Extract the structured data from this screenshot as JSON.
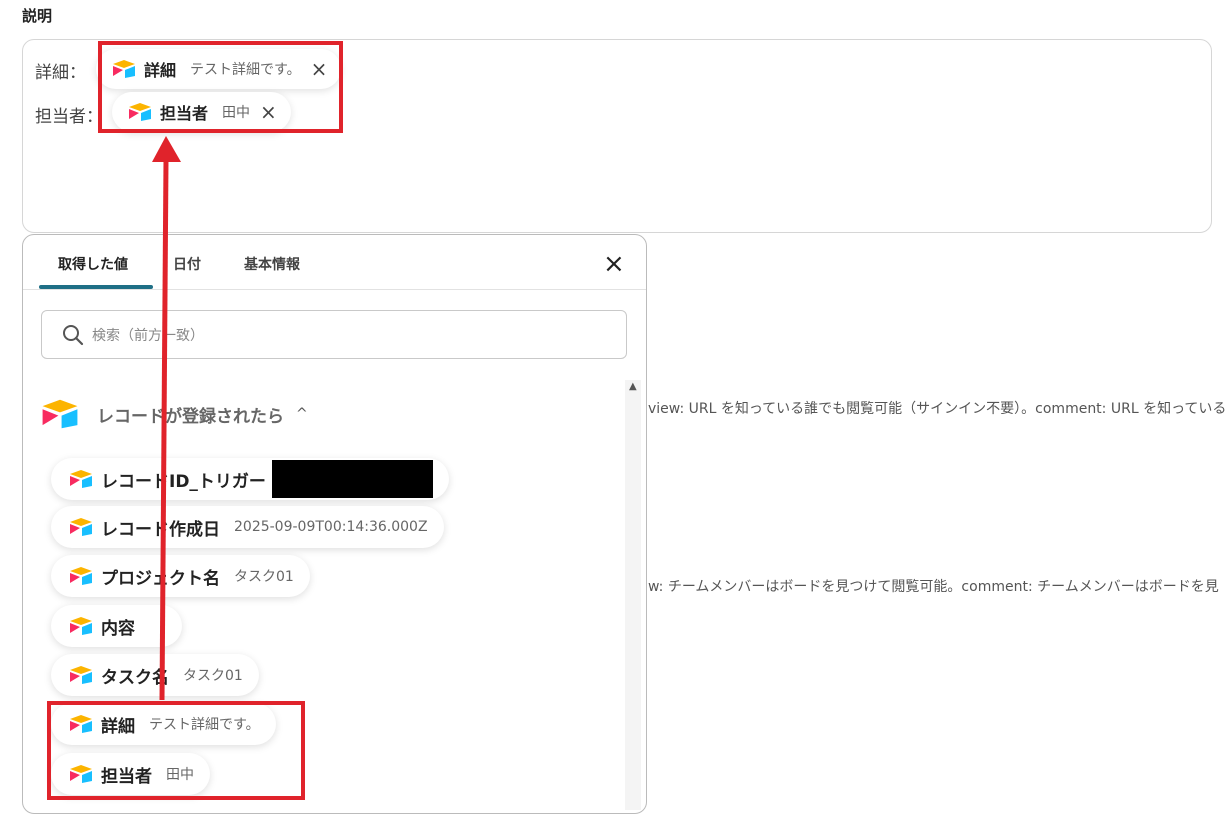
{
  "section_label": "説明",
  "description_field": {
    "rows": [
      {
        "label": "詳細：",
        "chip_name": "詳細",
        "chip_value": "テスト詳細です。",
        "remove": "×"
      },
      {
        "label": "担当者：",
        "chip_name": "担当者",
        "chip_value": "田中",
        "remove": "×"
      }
    ]
  },
  "panel": {
    "tabs": [
      "取得した値",
      "日付",
      "基本情報"
    ],
    "active_tab": "取得した値",
    "close": "×",
    "search_placeholder": "検索（前方一致）",
    "group_title": "レコードが登録されたら",
    "group_chevron": "^",
    "items": [
      {
        "name": "レコードID_トリガー",
        "value": ""
      },
      {
        "name": "レコード作成日",
        "value": "2025-09-09T00:14:36.000Z"
      },
      {
        "name": "プロジェクト名",
        "value": "タスク01"
      },
      {
        "name": "内容",
        "value": ""
      },
      {
        "name": "タスク名",
        "value": "タスク01"
      },
      {
        "name": "詳細",
        "value": "テスト詳細です。"
      },
      {
        "name": "担当者",
        "value": "田中"
      }
    ]
  },
  "background_text": {
    "line1": "view: URL を知っている誰でも閲覧可能（サインイン不要）。comment: URL を知っている",
    "line2": "w: チームメンバーはボードを見つけて閲覧可能。comment: チームメンバーはボードを見"
  },
  "icons": {
    "airtable_logo": "airtable-logo-icon",
    "search": "search-icon",
    "close": "close-icon"
  },
  "colors": {
    "highlight_red": "#e0232b",
    "tab_underline": "#1f6f86"
  }
}
